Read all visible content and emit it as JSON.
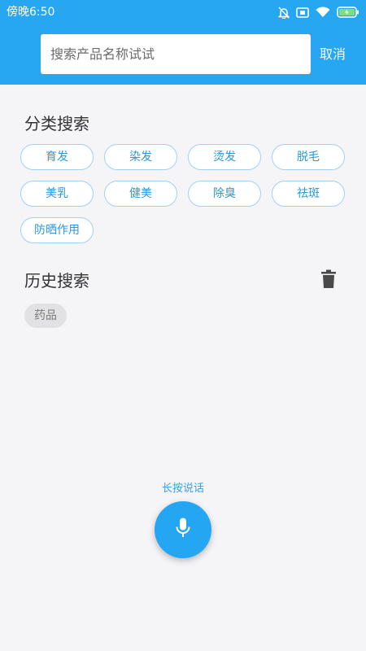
{
  "status_bar": {
    "time": "傍晚6:50",
    "icons": [
      "bell-off-icon",
      "screen-icon",
      "wifi-icon",
      "battery-charging-icon"
    ]
  },
  "search": {
    "placeholder": "搜索产品名称试试",
    "value": "",
    "cancel_label": "取消"
  },
  "categories": {
    "title": "分类搜索",
    "items": [
      "育发",
      "染发",
      "烫发",
      "脱毛",
      "美乳",
      "健美",
      "除臭",
      "祛斑",
      "防晒作用"
    ]
  },
  "history": {
    "title": "历史搜索",
    "clear_icon": "trash-icon",
    "items": [
      "药品"
    ]
  },
  "voice": {
    "label": "长按说话",
    "icon": "microphone-icon"
  },
  "colors": {
    "primary": "#27a6f2",
    "chip_border": "#9fd2f3",
    "chip_text": "#2b97df",
    "background": "#f5f4f7"
  }
}
